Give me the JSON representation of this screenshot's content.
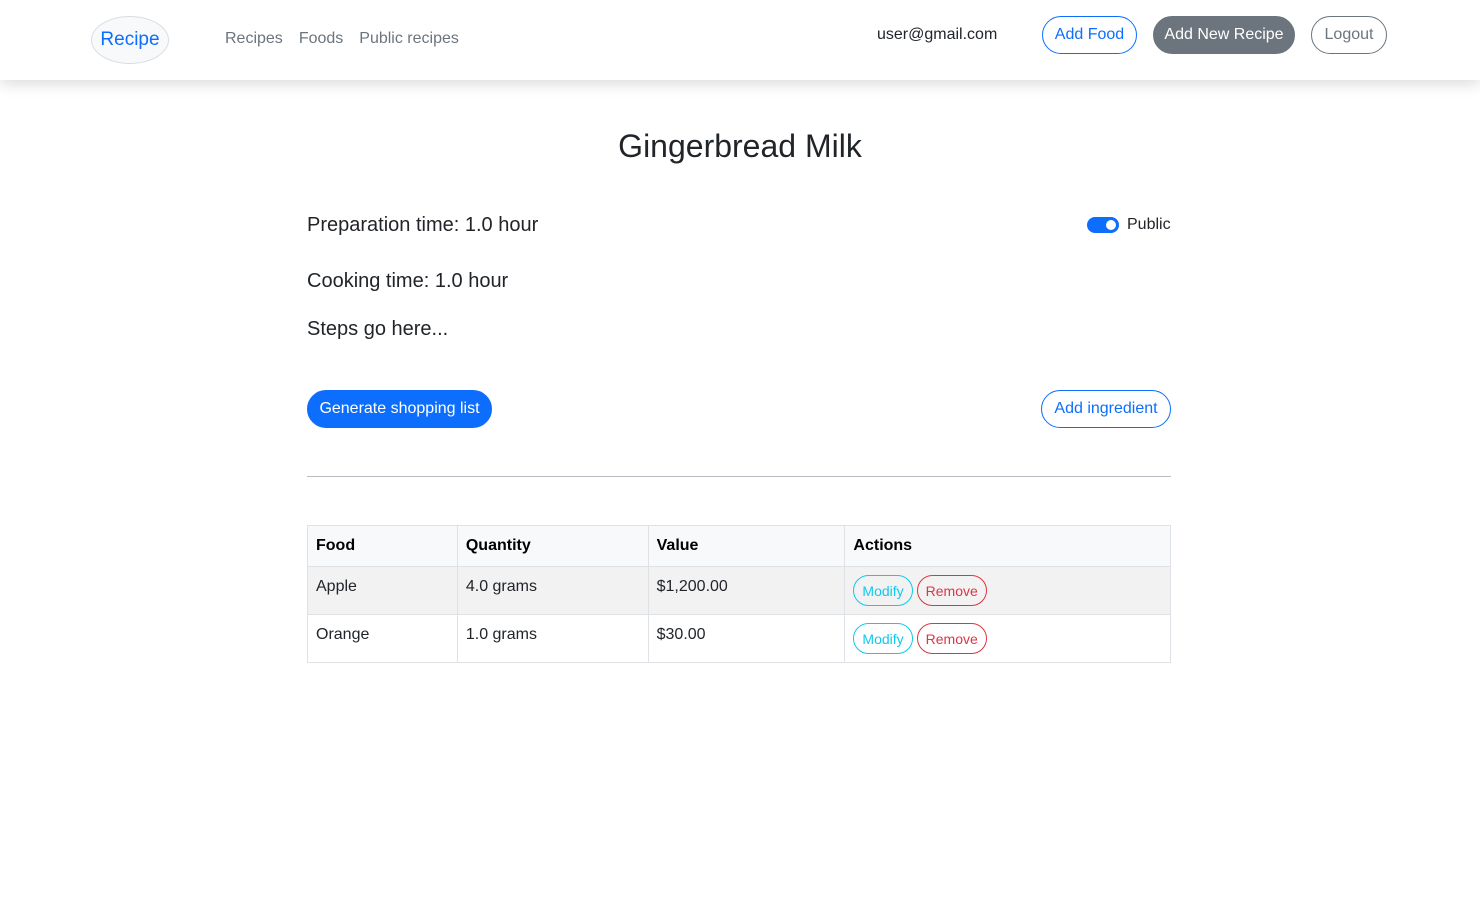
{
  "navbar": {
    "brand": "Recipe",
    "links": [
      "Recipes",
      "Foods",
      "Public recipes"
    ],
    "user_email": "user@gmail.com",
    "add_food": "Add Food",
    "add_new_recipe": "Add New Recipe",
    "logout": "Logout"
  },
  "recipe": {
    "title": "Gingerbread Milk",
    "preparation_time": "Preparation time: 1.0 hour",
    "cooking_time": "Cooking time: 1.0 hour",
    "steps": "Steps go here...",
    "public_label": "Public",
    "public": true
  },
  "actions": {
    "generate_shopping_list": "Generate shopping list",
    "add_ingredient": "Add ingredient"
  },
  "ingredients": {
    "headers": [
      "Food",
      "Quantity",
      "Value",
      "Actions"
    ],
    "rows": [
      {
        "food": "Apple",
        "quantity": "4.0 grams",
        "value": "$1,200.00",
        "modify": "Modify",
        "remove": "Remove"
      },
      {
        "food": "Orange",
        "quantity": "1.0 grams",
        "value": "$30.00",
        "modify": "Modify",
        "remove": "Remove"
      }
    ]
  },
  "colors": {
    "primary": "#0d6efd",
    "secondary": "#6c757d",
    "info": "#0dcaf0",
    "danger": "#dc3545"
  }
}
